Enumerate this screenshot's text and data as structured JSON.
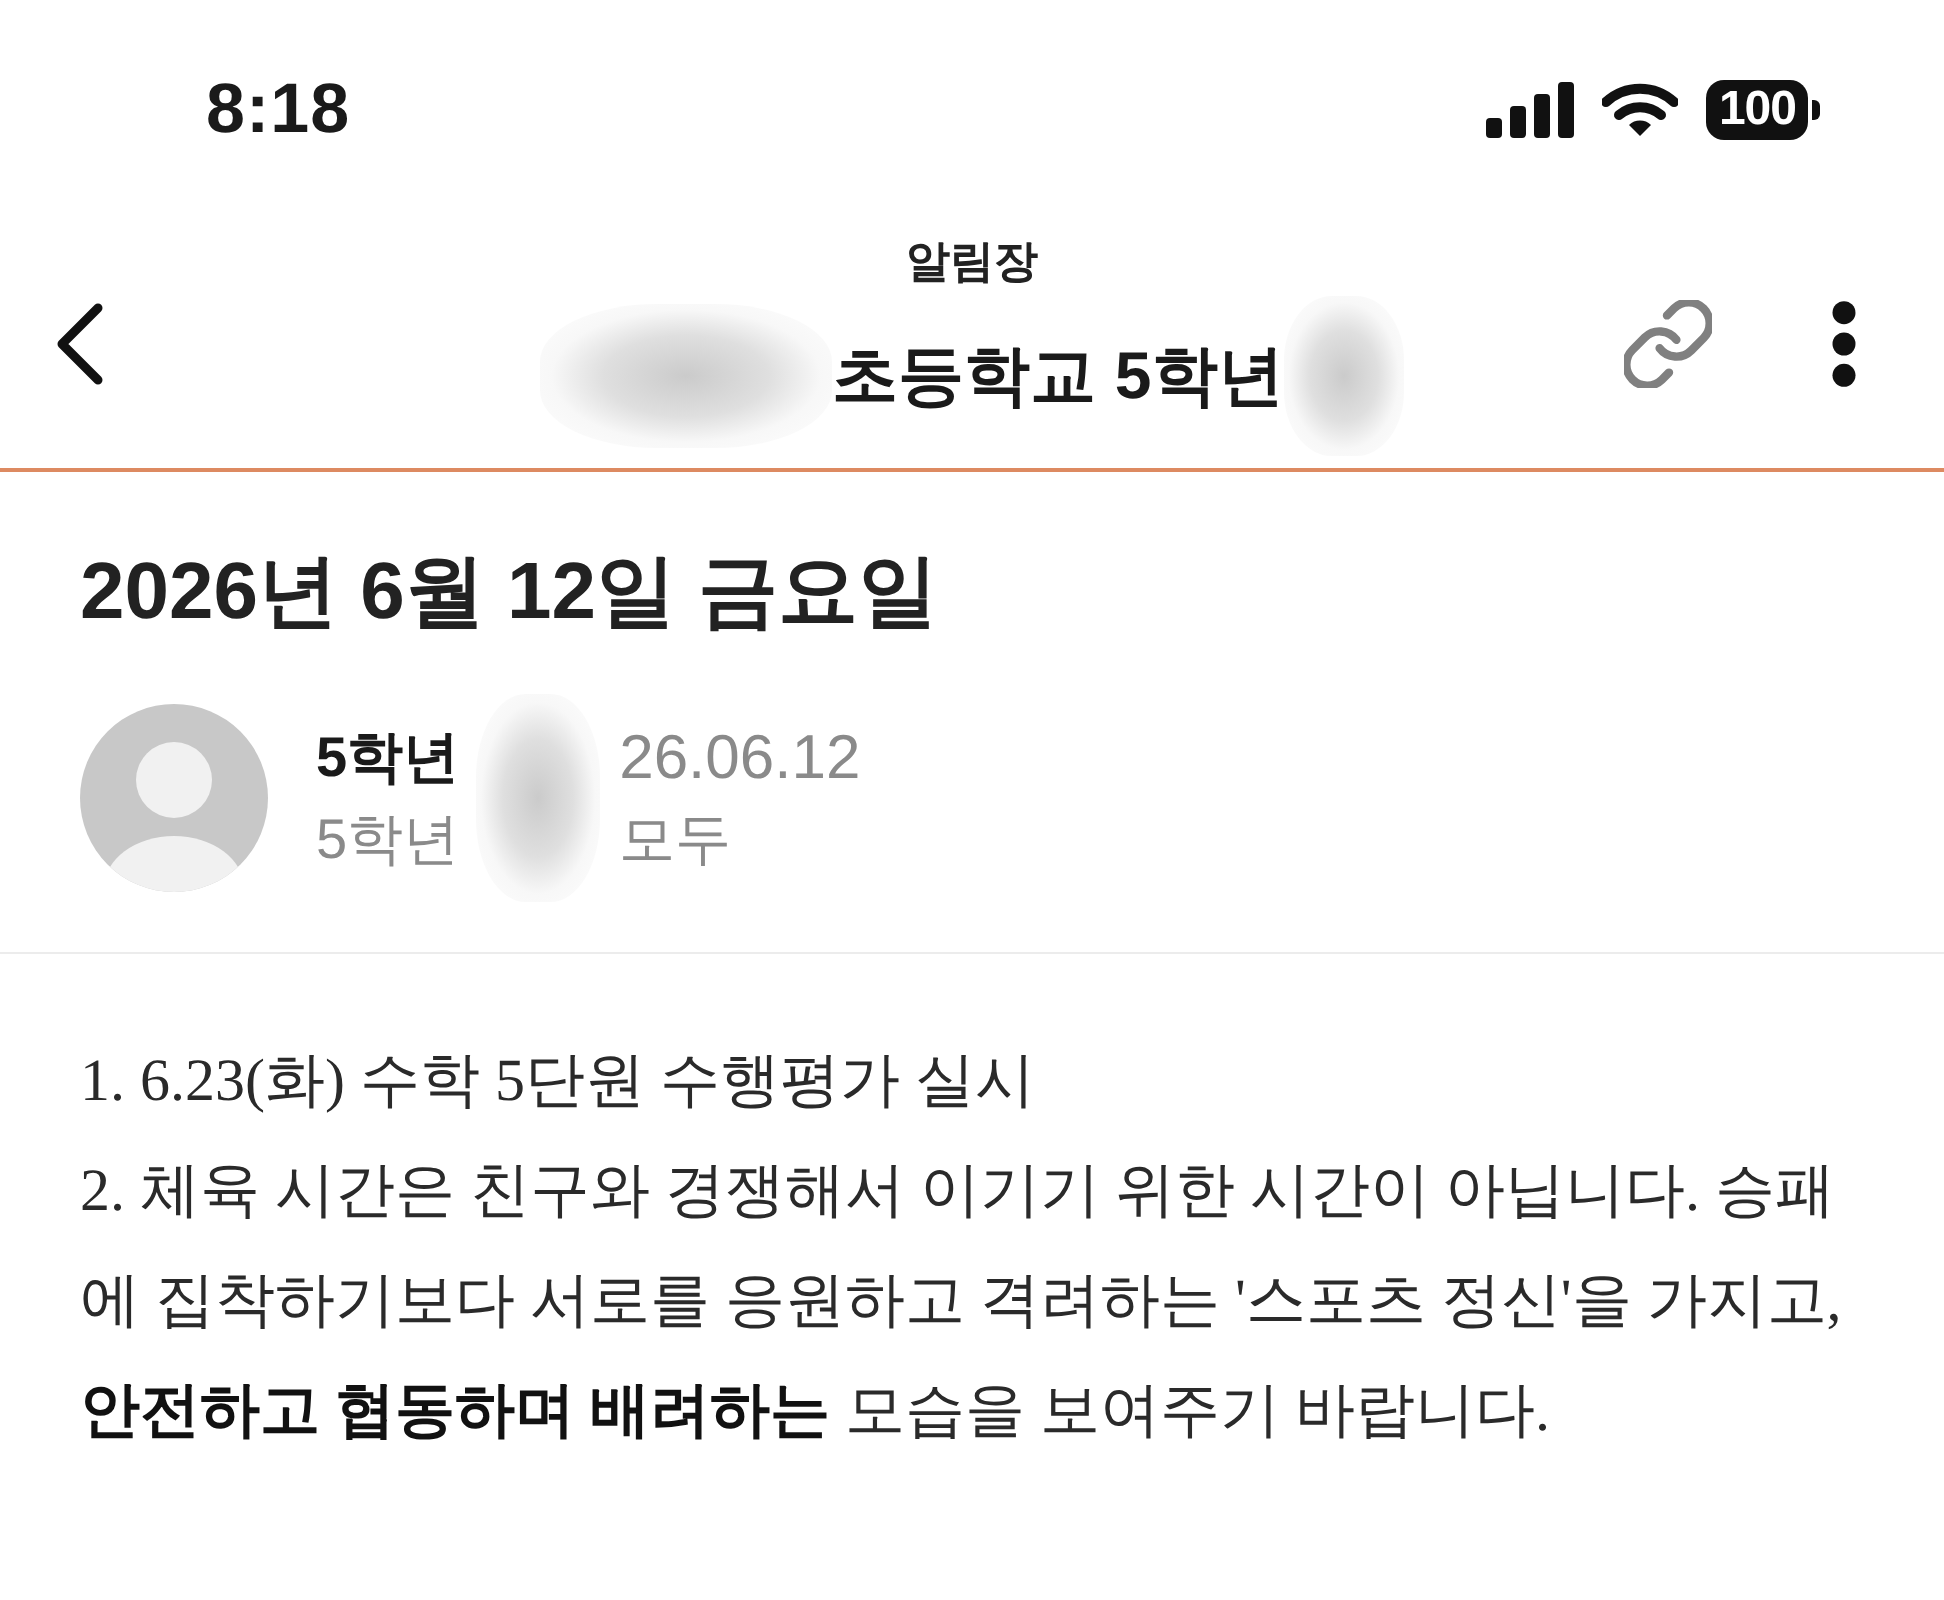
{
  "status_bar": {
    "time": "8:18",
    "battery": "100"
  },
  "header": {
    "subtitle": "알림장",
    "title": "초등학교 5학년"
  },
  "post": {
    "title": "2026년 6월 12일 금요일",
    "author": "5학년",
    "date": "26.06.12",
    "class": "5학년",
    "audience": "모두"
  },
  "body": [
    "1. 6.23(화) 수학 5단원 수행평가 실시",
    "2. 체육 시간은 친구와 경쟁해서 이기기 위한 시간이 아닙니다. 승패에 집착하기보다 서로를 응원하고 격려하는 '스포츠 정신'을 가지고, **안전하고 협동하며 배려하는** 모습을 보여주기 바랍니다."
  ]
}
